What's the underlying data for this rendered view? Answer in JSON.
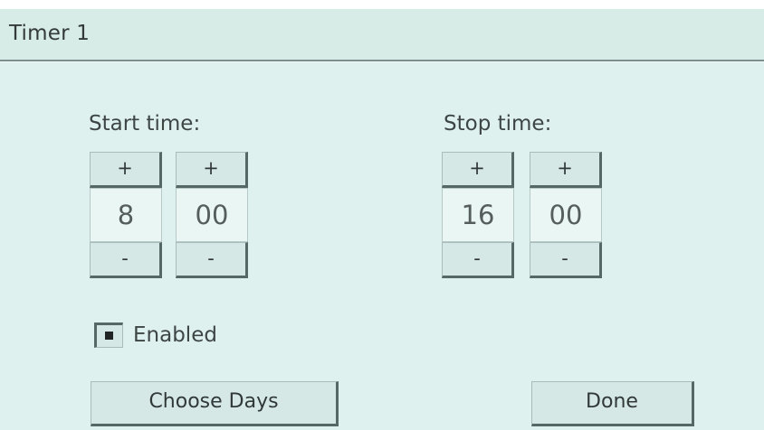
{
  "window": {
    "title": "Timer 1"
  },
  "start": {
    "label": "Start time:",
    "hour": {
      "inc": "+",
      "value": "8",
      "dec": "-"
    },
    "minute": {
      "inc": "+",
      "value": "00",
      "dec": "-"
    }
  },
  "stop": {
    "label": "Stop time:",
    "hour": {
      "inc": "+",
      "value": "16",
      "dec": "-"
    },
    "minute": {
      "inc": "+",
      "value": "00",
      "dec": "-"
    }
  },
  "enabled": {
    "checked": true,
    "label": "Enabled"
  },
  "buttons": {
    "choose_days": "Choose Days",
    "done": "Done"
  },
  "colors": {
    "background": "#dff1ee",
    "button": "#d6e8e5",
    "text": "#343a3a"
  }
}
